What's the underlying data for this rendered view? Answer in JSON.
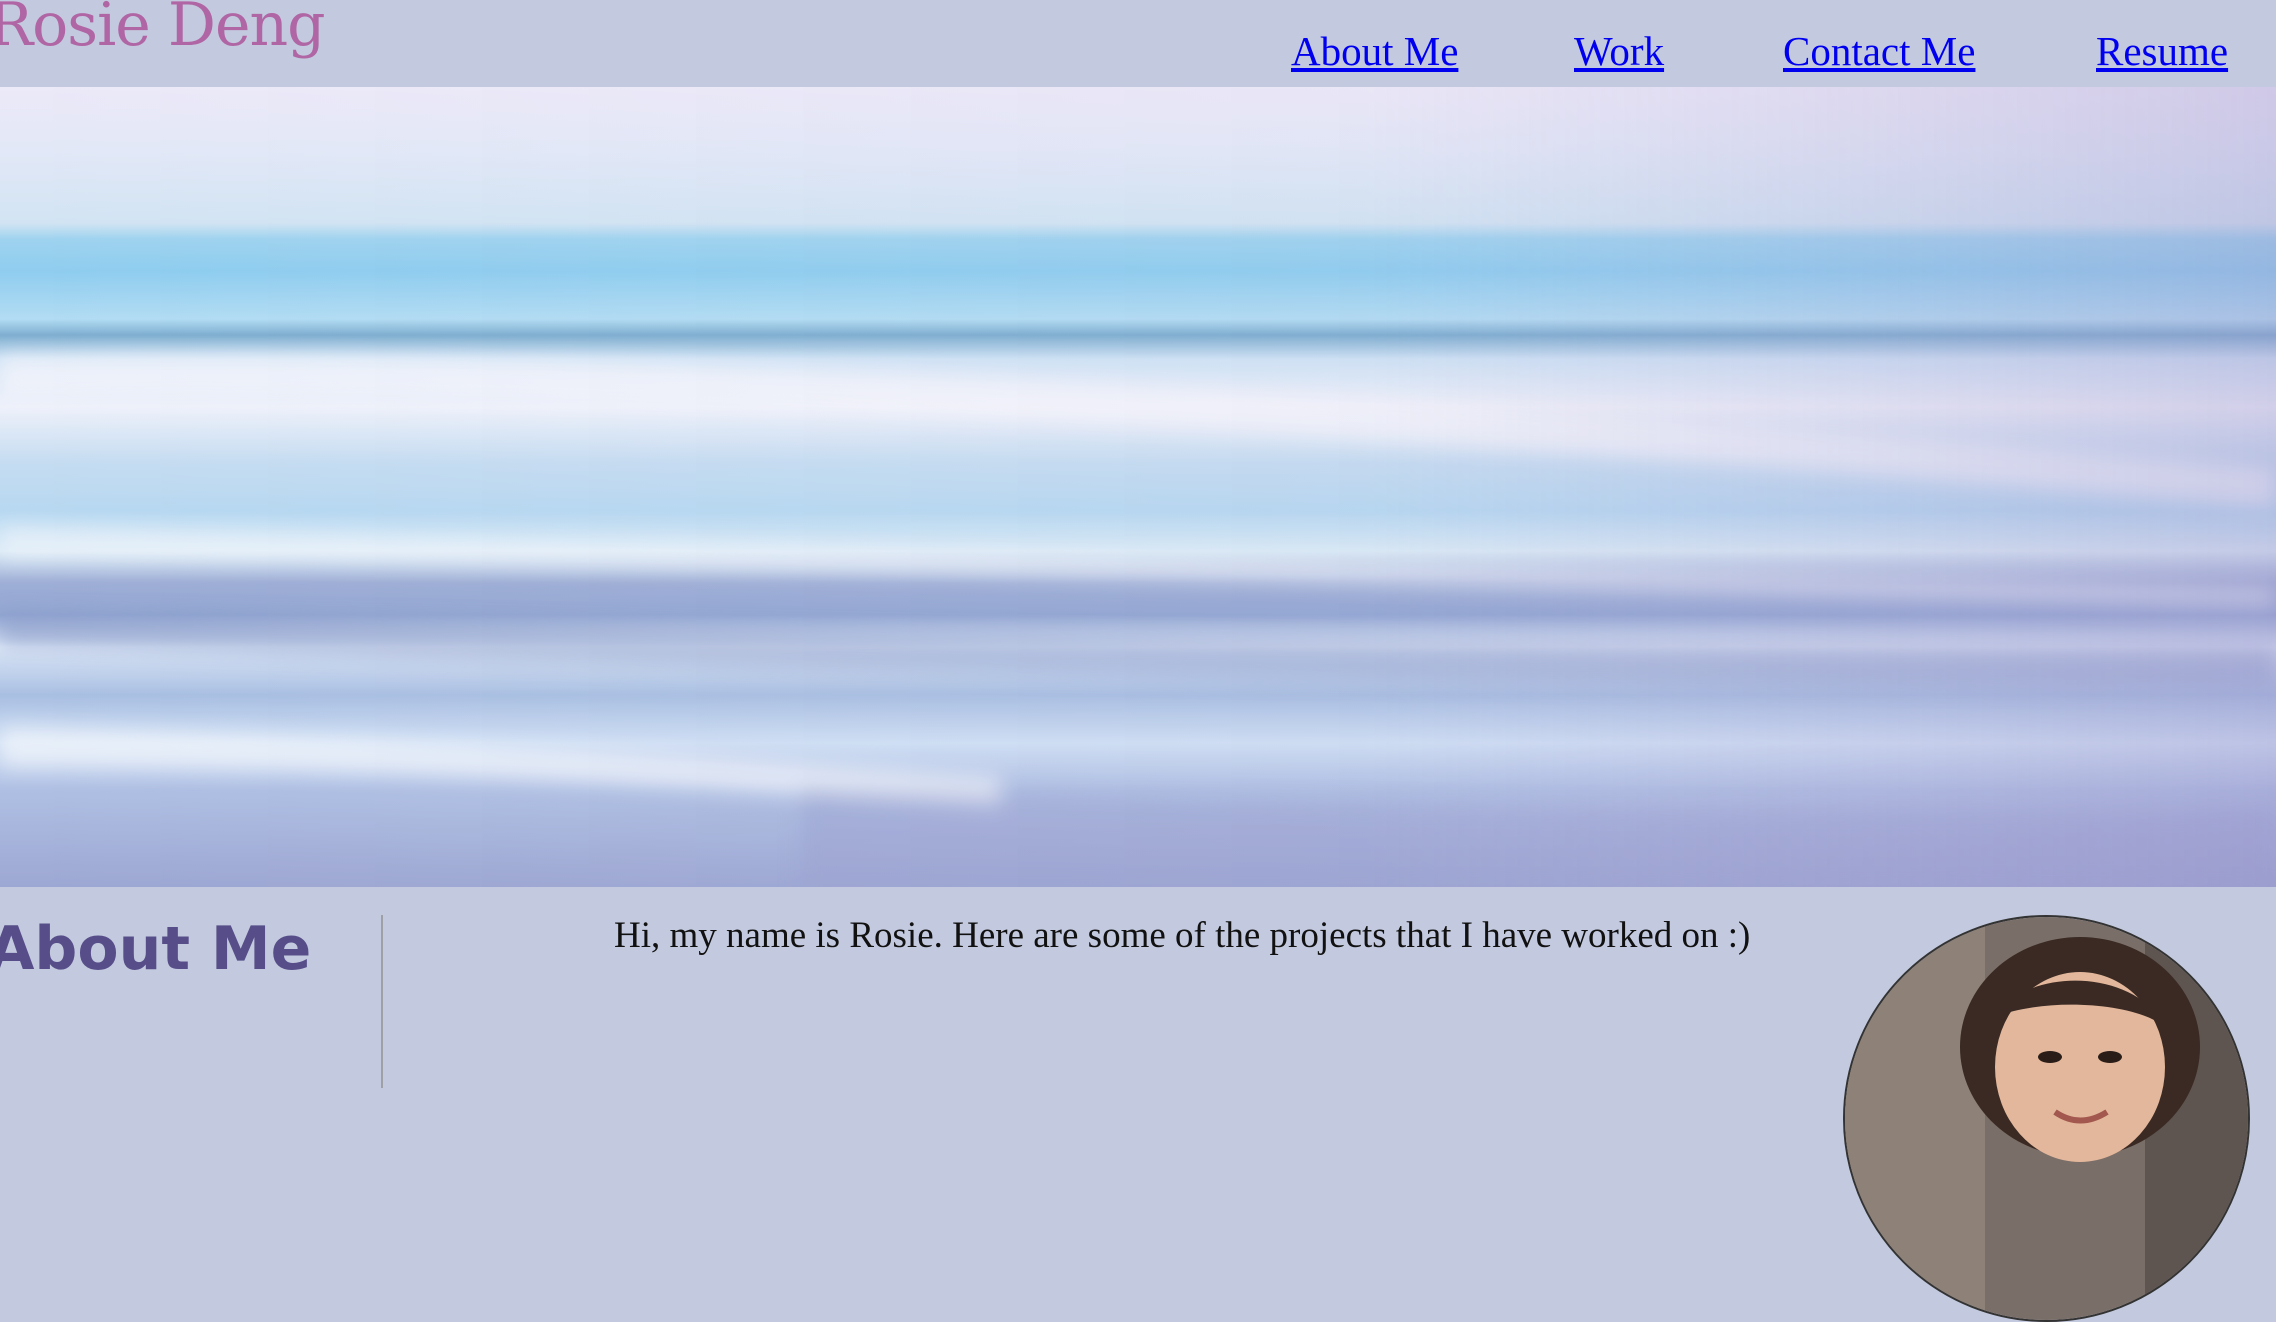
{
  "header": {
    "logo_text": "Rosie Deng",
    "nav": [
      "About Me",
      "Work",
      "Contact Me",
      "Resume"
    ]
  },
  "about": {
    "heading": "About Me",
    "intro": "Hi, my name is Rosie. Here are some of the projects that I have worked on :)"
  },
  "colors": {
    "page_bg": "#c3cadf",
    "logo": "#b066a4",
    "link": "#0000ee",
    "heading": "#574e89"
  }
}
